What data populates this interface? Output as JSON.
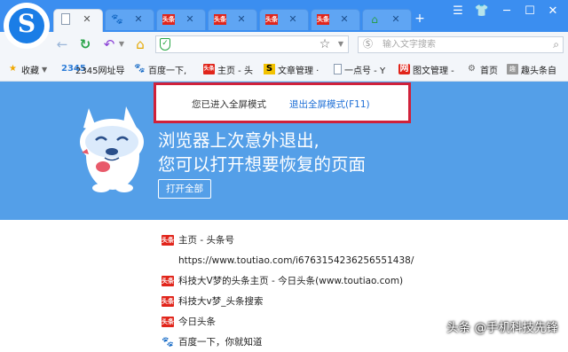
{
  "tabs": [
    {
      "label": "",
      "icon": "page-icon",
      "active": true
    },
    {
      "label": "",
      "icon": "baidu-paw-icon",
      "active": false
    },
    {
      "label": "头条",
      "icon": "toutiao-icon",
      "active": false
    },
    {
      "label": "头条",
      "icon": "toutiao-icon",
      "active": false
    },
    {
      "label": "头条",
      "icon": "toutiao-icon",
      "active": false
    },
    {
      "label": "头条",
      "icon": "toutiao-icon",
      "active": false
    },
    {
      "label": "",
      "icon": "house-icon",
      "active": false
    }
  ],
  "nav": {
    "search_placeholder": "输入文字搜索"
  },
  "bookmarks": [
    {
      "label": "收藏",
      "icon": "star-icon"
    },
    {
      "label": "2345网址导",
      "icon": "2345-icon"
    },
    {
      "label": "百度一下,",
      "icon": "baidu-paw-icon"
    },
    {
      "label": "主页 - 头",
      "icon": "toutiao-icon"
    },
    {
      "label": "文章管理 ·",
      "icon": "s-icon"
    },
    {
      "label": "一点号 - Y",
      "icon": "page-icon"
    },
    {
      "label": "图文管理 -",
      "icon": "red-icon"
    },
    {
      "label": "首页",
      "icon": "settings-icon"
    },
    {
      "label": "趣头条自",
      "icon": "qutoutiao-icon"
    }
  ],
  "badges": {
    "toutiao": "头条",
    "two345": "2345",
    "s": "S",
    "red": "网",
    "qu": "趣"
  },
  "banner": {
    "message": "您已进入全屏模式",
    "exit_label": "退出全屏模式(F11)"
  },
  "hero": {
    "line1": "浏览器上次意外退出,",
    "line2": "您可以打开想要恢复的页面",
    "open_all": "打开全部"
  },
  "restore_list": [
    {
      "icon": "toutiao-icon",
      "title": "主页 - 头条号"
    },
    {
      "icon": "none",
      "title": "https://www.toutiao.com/i6763154236256551438/"
    },
    {
      "icon": "toutiao-icon",
      "title": "科技大V梦的头条主页 - 今日头条(www.toutiao.com)"
    },
    {
      "icon": "toutiao-icon",
      "title": "科技大v梦_头条搜索"
    },
    {
      "icon": "toutiao-icon",
      "title": "今日头条"
    },
    {
      "icon": "baidu-paw-icon",
      "title": "百度一下，你就知道"
    }
  ],
  "watermark": "头条 @手机科技先锋",
  "colors": {
    "tab_strip": "#3b8ef0",
    "hero": "#549fe8",
    "highlight_border": "#d0213a",
    "link": "#1e6fd6"
  }
}
